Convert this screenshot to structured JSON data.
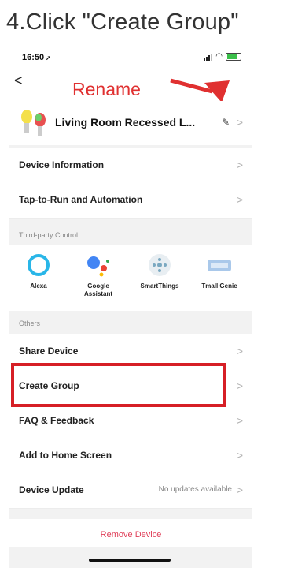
{
  "step_title": "4.Click \"Create Group\"",
  "status": {
    "time": "16:50"
  },
  "annotation": {
    "rename_label": "Rename"
  },
  "device": {
    "name": "Living Room Recessed L...",
    "edit_icon": "pencil-icon",
    "chevron": ">"
  },
  "back_icon": "<",
  "rows_top": [
    {
      "label": "Device Information"
    },
    {
      "label": "Tap-to-Run and Automation"
    }
  ],
  "third_party": {
    "section_label": "Third-party Control",
    "items": [
      {
        "name": "Alexa",
        "icon": "alexa-icon"
      },
      {
        "name": "Google Assistant",
        "icon": "google-assistant-icon"
      },
      {
        "name": "SmartThings",
        "icon": "smartthings-icon"
      },
      {
        "name": "Tmall Genie",
        "icon": "tmall-genie-icon"
      }
    ]
  },
  "others": {
    "section_label": "Others",
    "rows": [
      {
        "label": "Share Device",
        "value": ""
      },
      {
        "label": "Create Group",
        "value": ""
      },
      {
        "label": "FAQ & Feedback",
        "value": ""
      },
      {
        "label": "Add to Home Screen",
        "value": ""
      },
      {
        "label": "Device Update",
        "value": "No updates available"
      }
    ]
  },
  "remove_label": "Remove Device",
  "colors": {
    "accent_red": "#d61f26",
    "remove_text": "#e0405a"
  }
}
